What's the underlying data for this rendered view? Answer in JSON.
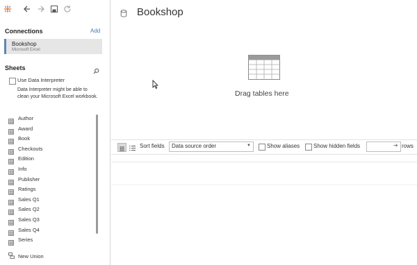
{
  "toolbar": {
    "icons": [
      "tableau-logo-icon",
      "back-arrow-icon",
      "forward-arrow-icon",
      "save-icon",
      "refresh-icon"
    ]
  },
  "connections": {
    "title": "Connections",
    "add_label": "Add",
    "item": {
      "name": "Bookshop",
      "type": "Microsoft Excel"
    }
  },
  "sheets": {
    "title": "Sheets",
    "use_interpreter_label": "Use Data Interpreter",
    "interpreter_description": "Data Interpreter might be able to clean your Microsoft Excel workbook.",
    "items": [
      "Author",
      "Award",
      "Book",
      "Checkouts",
      "Edition",
      "Info",
      "Publisher",
      "Ratings",
      "Sales Q1",
      "Sales Q2",
      "Sales Q3",
      "Sales Q4",
      "Series"
    ],
    "new_union_label": "New Union"
  },
  "canvas": {
    "datasource_title": "Bookshop",
    "drag_hint": "Drag tables here"
  },
  "grid_toolbar": {
    "sort_label": "Sort fields",
    "sort_value": "Data source order",
    "show_aliases_label": "Show aliases",
    "show_hidden_label": "Show hidden fields",
    "rows_label": "rows"
  },
  "colors": {
    "accent": "#5a88b7",
    "selected_bg": "#e6e6e6",
    "link": "#4a7ab0"
  }
}
